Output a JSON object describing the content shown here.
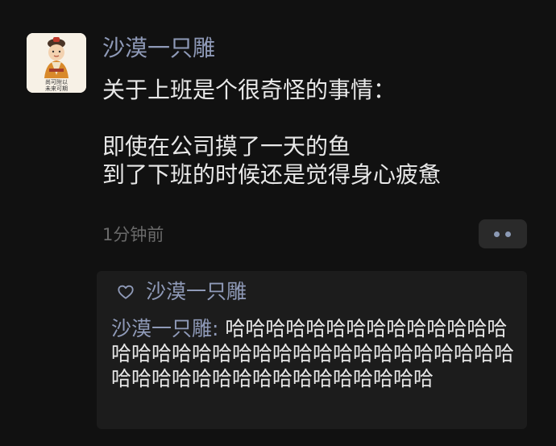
{
  "post": {
    "author": "沙漠一只雕",
    "avatar_icon": "cartoon-figure-avatar",
    "avatar_caption_lines": [
      "尚可附以",
      "未来可期"
    ],
    "content_lines": [
      "关于上班是个很奇怪的事情：",
      "",
      "即使在公司摸了一天的鱼",
      "到了下班的时候还是觉得身心疲惫"
    ],
    "time": "1分钟前",
    "more_icon": "more-dots-icon"
  },
  "likes": {
    "icon": "heart-icon",
    "names": "沙漠一只雕"
  },
  "comment": {
    "author": "沙漠一只雕",
    "separator": ": ",
    "text": "哈哈哈哈哈哈哈哈哈哈哈哈哈哈哈哈哈哈哈哈哈哈哈哈哈哈哈哈哈哈哈哈哈哈哈哈哈哈哈哈哈哈哈哈哈哈哈哈哈哈"
  },
  "colors": {
    "background": "#111111",
    "name_blue": "#8f9ab8",
    "text": "#e8e8e8",
    "muted": "#6a6a6a",
    "panel": "#1c1c1c"
  }
}
